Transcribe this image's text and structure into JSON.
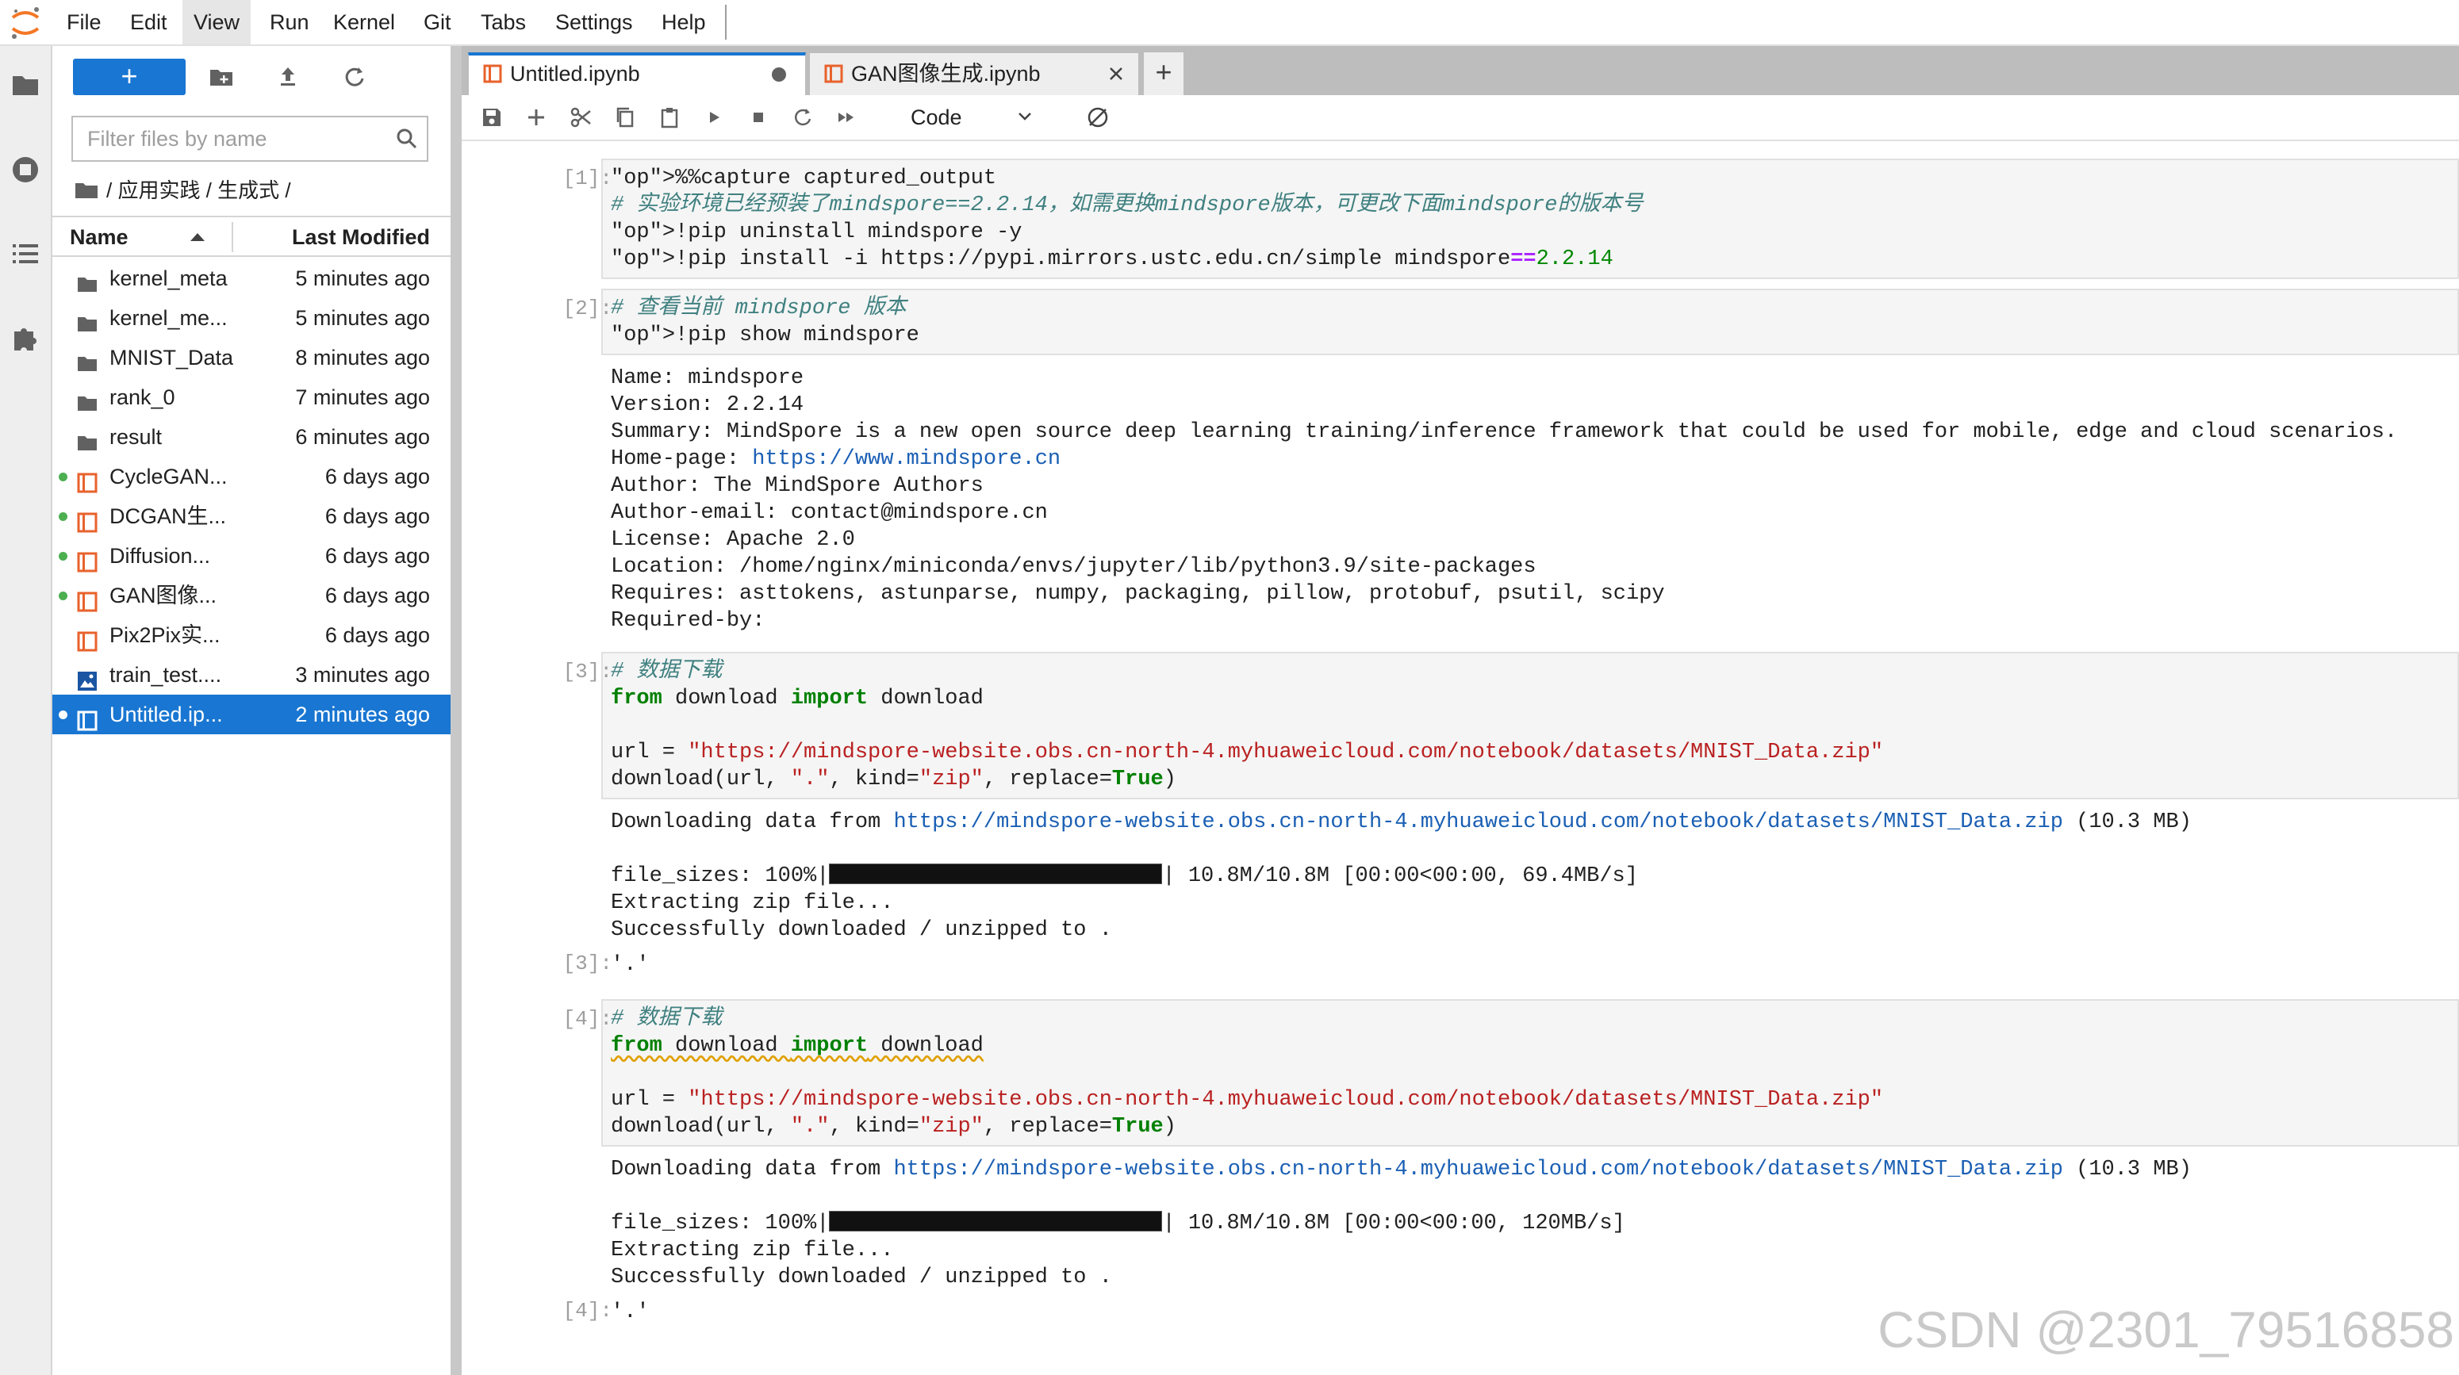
{
  "menubar": {
    "items": [
      "File",
      "Edit",
      "View",
      "Run",
      "Kernel",
      "Git",
      "Tabs",
      "Settings",
      "Help"
    ],
    "active_item": "View"
  },
  "filebrowser": {
    "new_button_label": "+",
    "filter_placeholder": "Filter files by name",
    "filter_value": "",
    "breadcrumb": "/ 应用实践 / 生成式 /",
    "column_name": "Name",
    "column_modified": "Last Modified",
    "files": [
      {
        "name": "kernel_meta",
        "modified": "5 minutes ago",
        "type": "folder",
        "running": false,
        "selected": false
      },
      {
        "name": "kernel_me...",
        "modified": "5 minutes ago",
        "type": "folder",
        "running": false,
        "selected": false
      },
      {
        "name": "MNIST_Data",
        "modified": "8 minutes ago",
        "type": "folder",
        "running": false,
        "selected": false
      },
      {
        "name": "rank_0",
        "modified": "7 minutes ago",
        "type": "folder",
        "running": false,
        "selected": false
      },
      {
        "name": "result",
        "modified": "6 minutes ago",
        "type": "folder",
        "running": false,
        "selected": false
      },
      {
        "name": "CycleGAN...",
        "modified": "6 days ago",
        "type": "notebook",
        "running": true,
        "selected": false
      },
      {
        "name": "DCGAN生...",
        "modified": "6 days ago",
        "type": "notebook",
        "running": true,
        "selected": false
      },
      {
        "name": "Diffusion...",
        "modified": "6 days ago",
        "type": "notebook",
        "running": true,
        "selected": false
      },
      {
        "name": "GAN图像...",
        "modified": "6 days ago",
        "type": "notebook",
        "running": true,
        "selected": false
      },
      {
        "name": "Pix2Pix实...",
        "modified": "6 days ago",
        "type": "notebook",
        "running": false,
        "selected": false
      },
      {
        "name": "train_test....",
        "modified": "3 minutes ago",
        "type": "image",
        "running": false,
        "selected": false
      },
      {
        "name": "Untitled.ip...",
        "modified": "2 minutes ago",
        "type": "notebook",
        "running": true,
        "selected": true
      }
    ]
  },
  "tabs": [
    {
      "label": "Untitled.ipynb",
      "active": true,
      "dirty": true
    },
    {
      "label": "GAN图像生成.ipynb",
      "active": false,
      "dirty": false
    }
  ],
  "toolbar": {
    "cell_type": "Code"
  },
  "notebook": {
    "cells": [
      {
        "prompt": "[1]:",
        "code": [
          "%%capture captured_output",
          "# 实验环境已经预装了mindspore==2.2.14，如需更换mindspore版本，可更改下面mindspore的版本号",
          "!pip uninstall mindspore -y",
          "!pip install -i https://pypi.mirrors.ustc.edu.cn/simple mindspore==2.2.14"
        ]
      },
      {
        "prompt": "[2]:",
        "code": [
          "# 查看当前 mindspore 版本",
          "!pip show mindspore"
        ],
        "output": [
          "Name: mindspore",
          "Version: 2.2.14",
          "Summary: MindSpore is a new open source deep learning training/inference framework that could be used for mobile, edge and cloud scenarios.",
          "Home-page: https://www.mindspore.cn",
          "Author: The MindSpore Authors",
          "Author-email: contact@mindspore.cn",
          "License: Apache 2.0",
          "Location: /home/nginx/miniconda/envs/jupyter/lib/python3.9/site-packages",
          "Requires: asttokens, astunparse, numpy, packaging, pillow, protobuf, psutil, scipy",
          "Required-by:"
        ]
      },
      {
        "prompt": "[3]:",
        "out_prompt": "[3]:",
        "code": [
          "# 数据下载",
          "from download import download",
          "",
          "url = \"https://mindspore-website.obs.cn-north-4.myhuaweicloud.com/notebook/datasets/MNIST_Data.zip\"",
          "download(url, \".\", kind=\"zip\", replace=True)"
        ],
        "download_prefix": "Downloading data from ",
        "download_url": "https://mindspore-website.obs.cn-north-4.myhuaweicloud.com/notebook/datasets/MNIST_Data.zip",
        "download_size": " (10.3 MB)",
        "progress_prefix": "file_sizes: 100%|",
        "progress_fraction": 1.0,
        "progress_suffix": "| 10.8M/10.8M [00:00<00:00, 69.4MB/s]",
        "output_tail": [
          "Extracting zip file...",
          "Successfully downloaded / unzipped to ."
        ],
        "result": "'.'"
      },
      {
        "prompt": "[4]:",
        "out_prompt": "[4]:",
        "code": [
          "# 数据下载",
          "from download import download",
          "",
          "url = \"https://mindspore-website.obs.cn-north-4.myhuaweicloud.com/notebook/datasets/MNIST_Data.zip\"",
          "download(url, \".\", kind=\"zip\", replace=True)"
        ],
        "download_prefix": "Downloading data from ",
        "download_url": "https://mindspore-website.obs.cn-north-4.myhuaweicloud.com/notebook/datasets/MNIST_Data.zip",
        "download_size": " (10.3 MB)",
        "progress_prefix": "file_sizes: 100%|",
        "progress_fraction": 1.0,
        "progress_suffix": "| 10.8M/10.8M [00:00<00:00, 120MB/s]",
        "output_tail": [
          "Extracting zip file...",
          "Successfully downloaded / unzipped to ."
        ],
        "result": "'.'"
      }
    ]
  },
  "watermark": "CSDN @2301_79516858",
  "colors": {
    "accent": "#1976d2",
    "running_dot": "#4caf50",
    "notebook_icon": "#e8622c",
    "comment": "#408080",
    "keyword": "#008000",
    "string": "#ba2121"
  }
}
